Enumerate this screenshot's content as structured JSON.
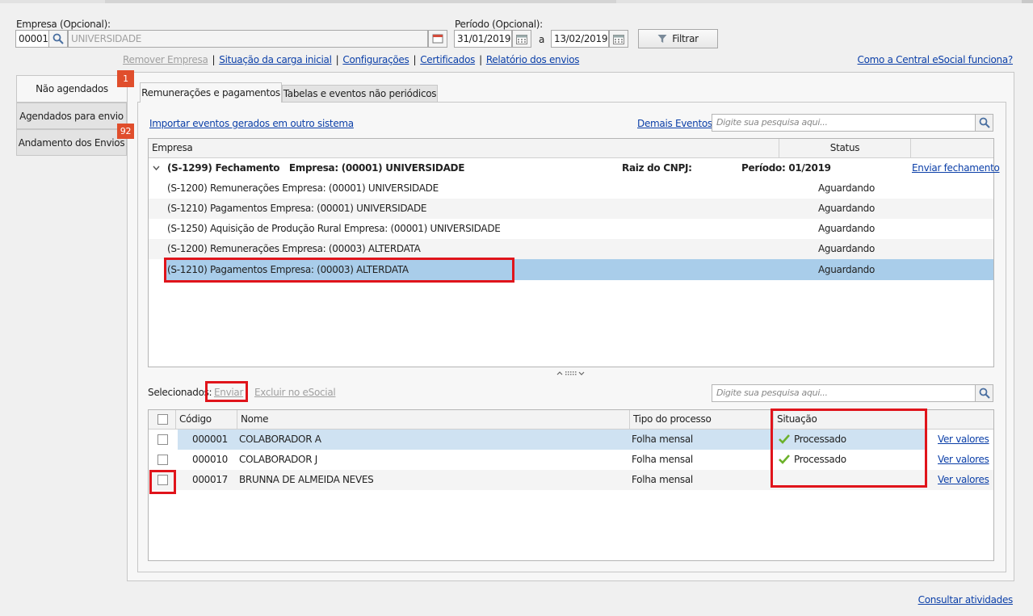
{
  "filters": {
    "empresa_label": "Empresa (Opcional):",
    "empresa_code": "00001",
    "empresa_name": "UNIVERSIDADE",
    "periodo_label": "Período (Opcional):",
    "periodo_from": "31/01/2019",
    "periodo_sep": "a",
    "periodo_to": "13/02/2019",
    "filtrar_label": "Filtrar"
  },
  "links": {
    "remover_empresa": "Remover Empresa",
    "situacao_carga": "Situação da carga inicial",
    "configuracoes": "Configurações",
    "certificados": "Certificados",
    "relatorio_envios": "Relatório dos envios",
    "separator": "|",
    "como_funciona": "Como a Central eSocial funciona?",
    "consultar_atividades": "Consultar atividades"
  },
  "side_tabs": [
    {
      "label": "Não agendados",
      "badge": "1"
    },
    {
      "label": "Agendados para envio",
      "badge": ""
    },
    {
      "label": "Andamento dos Envios",
      "badge": "92"
    }
  ],
  "top_tabs": [
    {
      "label": "Remunerações e pagamentos"
    },
    {
      "label": "Tabelas e eventos não periódicos"
    }
  ],
  "events": {
    "importar_link": "Importar eventos gerados em outro sistema",
    "demais_eventos": "Demais Eventos",
    "search_placeholder": "Digite sua pesquisa aqui...",
    "columns": {
      "empresa": "Empresa",
      "status": "Status"
    },
    "group": {
      "title": "(S-1299) Fechamento   Empresa: (00001) UNIVERSIDADE",
      "raiz": "Raiz do CNPJ:",
      "periodo": "Período: 01/2019",
      "action": "Enviar fechamento"
    },
    "rows": [
      {
        "desc": "(S-1200) Remunerações Empresa: (00001) UNIVERSIDADE",
        "status": "Aguardando"
      },
      {
        "desc": "(S-1210) Pagamentos Empresa: (00001) UNIVERSIDADE",
        "status": "Aguardando"
      },
      {
        "desc": "(S-1250) Aquisição de Produção Rural Empresa: (00001) UNIVERSIDADE",
        "status": "Aguardando"
      },
      {
        "desc": "(S-1200) Remunerações Empresa: (00003) ALTERDATA",
        "status": "Aguardando"
      },
      {
        "desc": "(S-1210) Pagamentos Empresa: (00003) ALTERDATA",
        "status": "Aguardando"
      }
    ]
  },
  "selected": {
    "label": "Selecionados:",
    "enviar": "Enviar",
    "excluir": "Excluir no eSocial",
    "search_placeholder": "Digite sua pesquisa aqui...",
    "columns": {
      "codigo": "Código",
      "nome": "Nome",
      "tipo": "Tipo do processo",
      "situacao": "Situação"
    },
    "rows": [
      {
        "codigo": "000001",
        "nome": "COLABORADOR A",
        "tipo": "Folha mensal",
        "situacao": "Processado",
        "action": "Ver valores"
      },
      {
        "codigo": "000010",
        "nome": "COLABORADOR J",
        "tipo": "Folha mensal",
        "situacao": "Processado",
        "action": "Ver valores"
      },
      {
        "codigo": "000017",
        "nome": "BRUNNA DE ALMEIDA NEVES",
        "tipo": "Folha mensal",
        "situacao": "",
        "action": "Ver valores"
      }
    ]
  },
  "colors": {
    "highlight_red": "#e0141b",
    "selected_row": "#a9cdea",
    "badge": "#e04e2c",
    "link": "#0b3fa8"
  }
}
